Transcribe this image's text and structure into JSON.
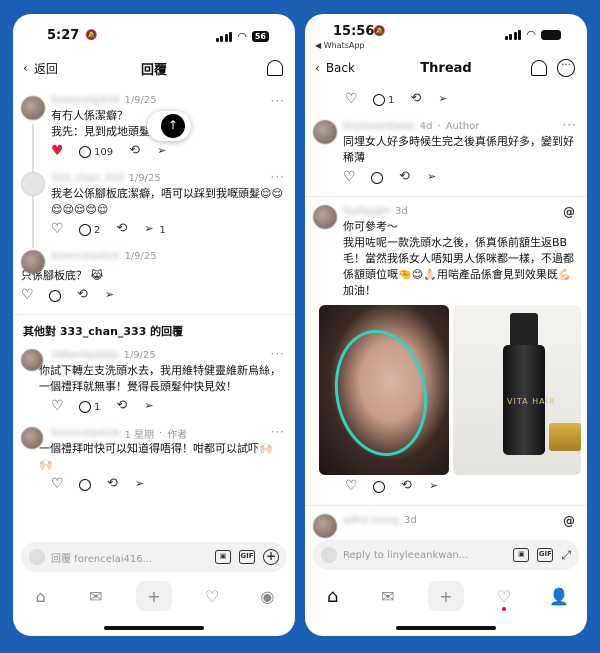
{
  "left": {
    "status_time": "5:27",
    "battery": "56",
    "back_label": "返回",
    "title": "回覆",
    "posts": [
      {
        "name": "forencelai416",
        "time": "1/9/25",
        "text": "有冇人係潔癖？",
        "quote": "我先：見到成地頭髮就想嘔",
        "likes": "",
        "comments": "109"
      },
      {
        "name": "333_chan_333",
        "time": "1/9/25",
        "text": "我老公係腳板底潔癖，唔可以踩到我嘅頭髮😌😌😌😌😌😌😌",
        "comments": "2",
        "shares": "1"
      },
      {
        "name": "forencelai416",
        "time": "1/9/25",
        "text": "只係腳板底？ 😹"
      }
    ],
    "section_title": "其他對 333_chan_333 的回覆",
    "other_replies": [
      {
        "name": "20familydaily",
        "time": "1/9/25",
        "text": "你試下轉左支洗頭水去，我用維特健靈維新烏絲，一個禮拜就無事！覺得長頭髮仲快見效！",
        "comments": "1"
      },
      {
        "name": "forencelai416",
        "time": "1 星期",
        "badge": "作者",
        "text": "一個禮拜咁快可以知道得唔得！咁都可以試吓🙌🏻🙌🏻"
      }
    ],
    "composer_placeholder": "回覆 forencelai416..."
  },
  "right": {
    "status_time": "15:56",
    "back_app": "◀ WhatsApp",
    "back_label": "Back",
    "title": "Thread",
    "top_actions_comments": "1",
    "posts": [
      {
        "name": "linyleeankwan",
        "time": "4d",
        "badge": "Author",
        "text": "同埋女人好多時候生完之後真係甩好多，變到好稀薄"
      },
      {
        "name": "fayfaygirl",
        "time": "3d",
        "text": "你可參考～\n我用咗呢一款洗頭水之後，係真係前額生返BB毛！當然我係女人唔知男人係咪都一樣，不過都係額頭位嘅🤏😊🙏🏻用啱產品係會見到效果既💪🏻加油！"
      },
      {
        "name": "adhd.loong",
        "time": "3d"
      }
    ],
    "product_label": "VITA HAIR",
    "composer_placeholder": "Reply to linyleeankwan..."
  }
}
